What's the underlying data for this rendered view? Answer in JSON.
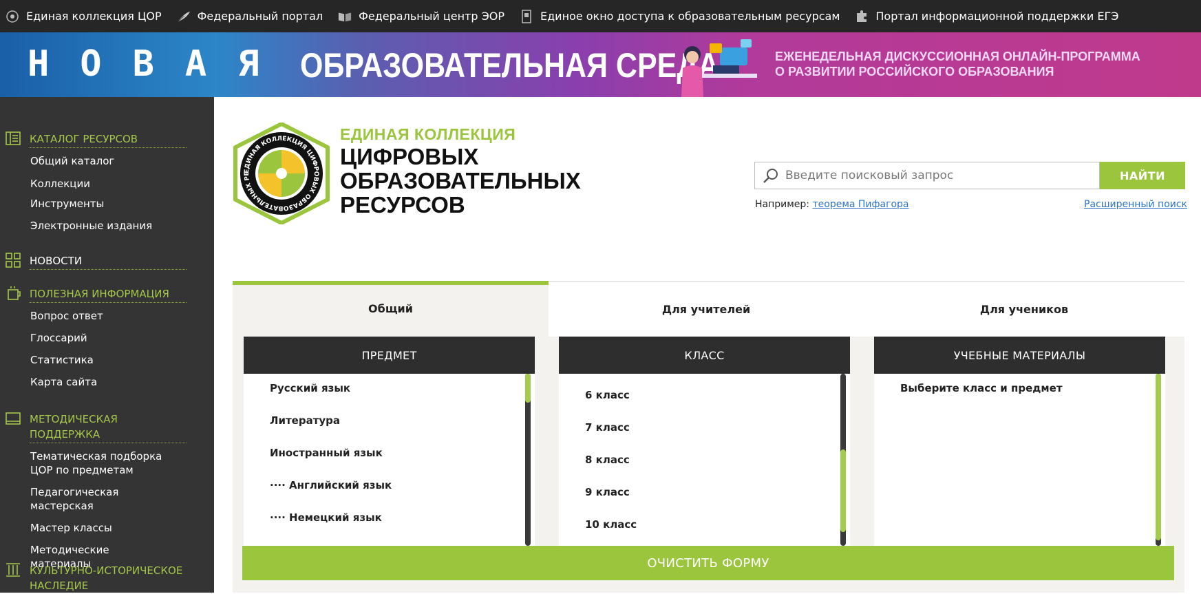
{
  "topnav": [
    {
      "label": "Единая коллекция ЦОР",
      "icon": "disc-icon"
    },
    {
      "label": "Федеральный портал",
      "icon": "feather-icon"
    },
    {
      "label": "Федеральный центр ЭОР",
      "icon": "book-icon"
    },
    {
      "label": "Единое окно доступа к образовательным ресурсам",
      "icon": "window-icon"
    },
    {
      "label": "Портал информационной поддержки ЕГЭ",
      "icon": "puzzle-icon"
    }
  ],
  "banner": {
    "word": "НОВАЯ",
    "title": "ОБРАЗОВАТЕЛЬНАЯ СРЕДА",
    "subtitle_line1": "ЕЖЕНЕДЕЛЬНАЯ ДИСКУССИОННАЯ ОНЛАЙН-ПРОГРАММА",
    "subtitle_line2": "О РАЗВИТИИ РОССИЙСКОГО ОБРАЗОВАНИЯ"
  },
  "sidebar": {
    "catalog": {
      "title": "КАТАЛОГ РЕСУРСОВ",
      "items": [
        "Общий каталог",
        "Коллекции",
        "Инструменты",
        "Электронные издания"
      ]
    },
    "news": {
      "title": "НОВОСТИ"
    },
    "useful": {
      "title": "ПОЛЕЗНАЯ ИНФОРМАЦИЯ",
      "items": [
        "Вопрос ответ",
        "Глоссарий",
        "Статистика",
        "Карта сайта"
      ]
    },
    "method": {
      "title": "МЕТОДИЧЕСКАЯ ПОДДЕРЖКА",
      "items": [
        "Тематическая подборка ЦОР по предметам",
        "Педагогическая мастерская",
        "Мастер классы",
        "Методические материалы"
      ]
    },
    "culture": {
      "title": "КУЛЬТУРНО-ИСТОРИЧЕСКОЕ НАСЛЕДИЕ"
    }
  },
  "brand": {
    "line1": "ЕДИНАЯ КОЛЛЕКЦИЯ",
    "line2": "ЦИФРОВЫХ",
    "line3": "ОБРАЗОВАТЕЛЬНЫХ",
    "line4": "РЕСУРСОВ",
    "seal_text": "ЕДИНАЯ КОЛЛЕКЦИЯ ЦИФРОВЫХ ОБРАЗОВАТЕЛЬНЫХ РЕСУРСОВ"
  },
  "search": {
    "placeholder": "Введите поисковый запрос",
    "button": "НАЙТИ",
    "example_prefix": "Например:",
    "example_link": "теорема Пифагора",
    "advanced": "Расширенный поиск"
  },
  "tabs": [
    "Общий",
    "Для учителей",
    "Для учеников"
  ],
  "columns": {
    "subject": {
      "title": "ПРЕДМЕТ",
      "items": [
        "Русский язык",
        "Литература",
        "Иностранный язык",
        "···· Английский язык",
        "···· Немецкий язык"
      ]
    },
    "grade": {
      "title": "КЛАСС",
      "items": [
        "6 класс",
        "7 класс",
        "8 класс",
        "9 класс",
        "10 класс"
      ]
    },
    "materials": {
      "title": "УЧЕБНЫЕ МАТЕРИАЛЫ",
      "items": [
        "Выберите класс и предмет"
      ]
    }
  },
  "clear_button": "ОЧИСТИТЬ ФОРМУ",
  "colors": {
    "accent": "#9bc53d",
    "dark": "#343434",
    "topbar": "#262626"
  }
}
